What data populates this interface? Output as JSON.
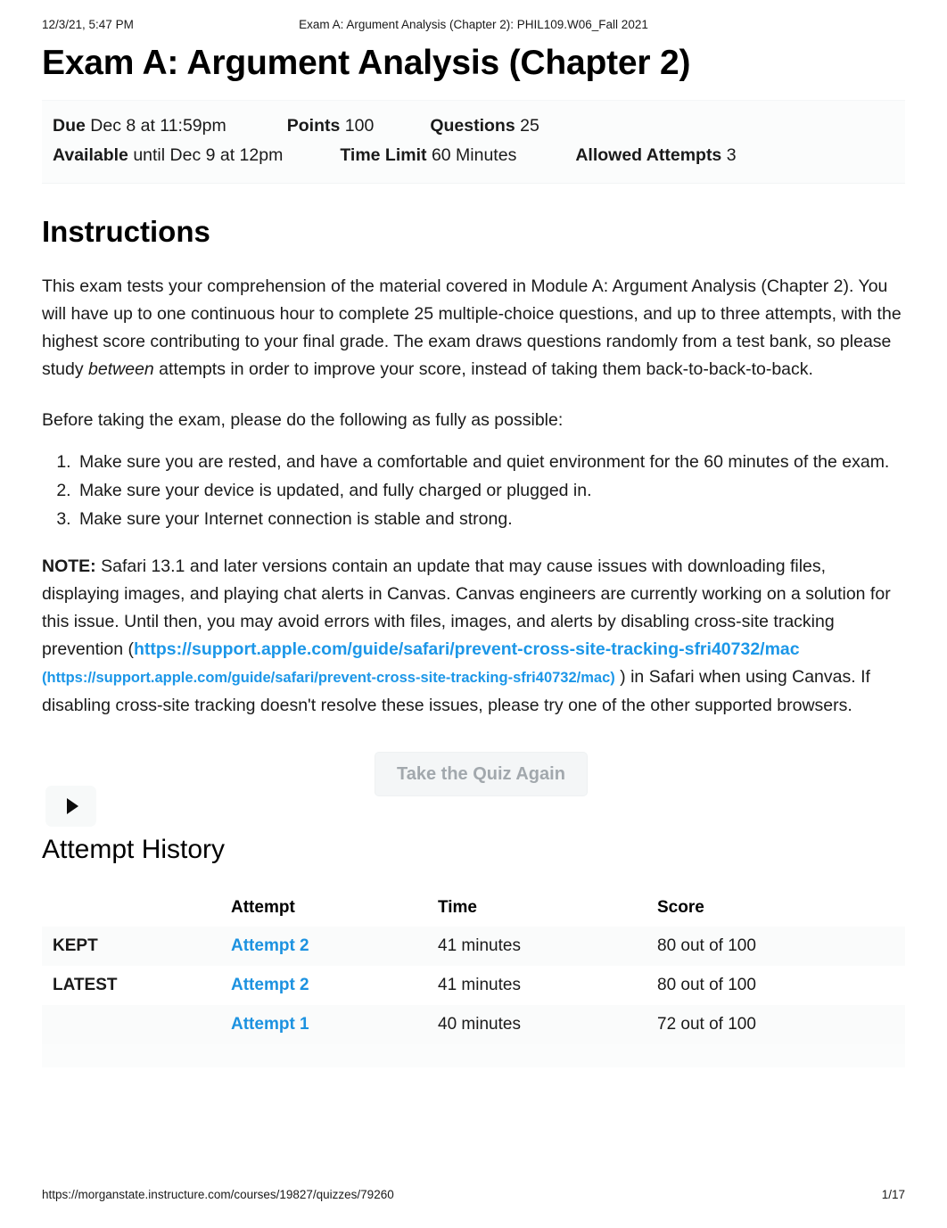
{
  "print_header": {
    "date": "12/3/21, 5:47 PM",
    "title": "Exam A: Argument Analysis (Chapter 2): PHIL109.W06_Fall 2021"
  },
  "quiz": {
    "title": "Exam A: Argument Analysis (Chapter 2)",
    "details": {
      "due_label": "Due",
      "due_value": "Dec 8 at 11:59pm",
      "points_label": "Points",
      "points_value": "100",
      "questions_label": "Questions",
      "questions_value": "25",
      "available_label": "Available",
      "available_value": "until Dec 9 at 12pm",
      "time_limit_label": "Time Limit",
      "time_limit_value": "60 Minutes",
      "allowed_attempts_label": "Allowed Attempts",
      "allowed_attempts_value": "3"
    }
  },
  "instructions": {
    "heading": "Instructions",
    "paragraph1_part1": "This exam tests your comprehension of the material covered in Module A: Argument Analysis (Chapter 2). You will have up to one continuous hour to complete 25 multiple-choice questions, and up to three attempts, with the highest score contributing to your final grade. The exam draws questions randomly from a test bank, so please study ",
    "paragraph1_emphasis": "between",
    "paragraph1_part2": " attempts in order to improve your score, instead of taking them back-to-back-to-back.",
    "paragraph2": "Before taking the exam, please do the following as fully as possible:",
    "steps": [
      "Make sure you are rested, and have a comfortable and quiet environment for the 60 minutes of the exam.",
      "Make sure your device is updated, and fully charged or plugged in.",
      "Make sure your Internet connection is stable and strong."
    ],
    "note_label": "NOTE:",
    "note_part1": " Safari 13.1 and later versions contain an update that may cause issues with downloading files, displaying images, and playing chat alerts in Canvas. Canvas engineers are currently working on a solution for this issue. Until then, you may avoid errors with files, images, and alerts by disabling cross-site tracking prevention (",
    "note_link_text": "https://support.apple.com/guide/safari/prevent-cross-site-tracking-sfri40732/mac",
    "note_link_url_display": "(https://support.apple.com/guide/safari/prevent-cross-site-tracking-sfri40732/mac)",
    "note_part2": " ) in Safari when using Canvas. If disabling cross-site tracking doesn't resolve these issues, please try one of the other supported browsers."
  },
  "actions": {
    "take_quiz_again_label": "Take the Quiz Again",
    "play_icon": "play-icon"
  },
  "attempt_history": {
    "heading": "Attempt History",
    "columns": [
      "",
      "Attempt",
      "Time",
      "Score"
    ],
    "rows": [
      {
        "flag": "KEPT",
        "attempt": "Attempt 2",
        "time": "41 minutes",
        "score": "80 out of 100"
      },
      {
        "flag": "LATEST",
        "attempt": "Attempt 2",
        "time": "41 minutes",
        "score": "80 out of 100"
      },
      {
        "flag": "",
        "attempt": "Attempt 1",
        "time": "40 minutes",
        "score": "72 out of 100"
      }
    ]
  },
  "print_footer": {
    "url": "https://morganstate.instructure.com/courses/19827/quizzes/79260",
    "page": "1/17"
  },
  "colors": {
    "link_blue": "#1c97e8",
    "attempt_link_blue": "#1c92e0",
    "disabled_button_text": "#a2a8ad",
    "body_text": "#1a1a1a"
  }
}
